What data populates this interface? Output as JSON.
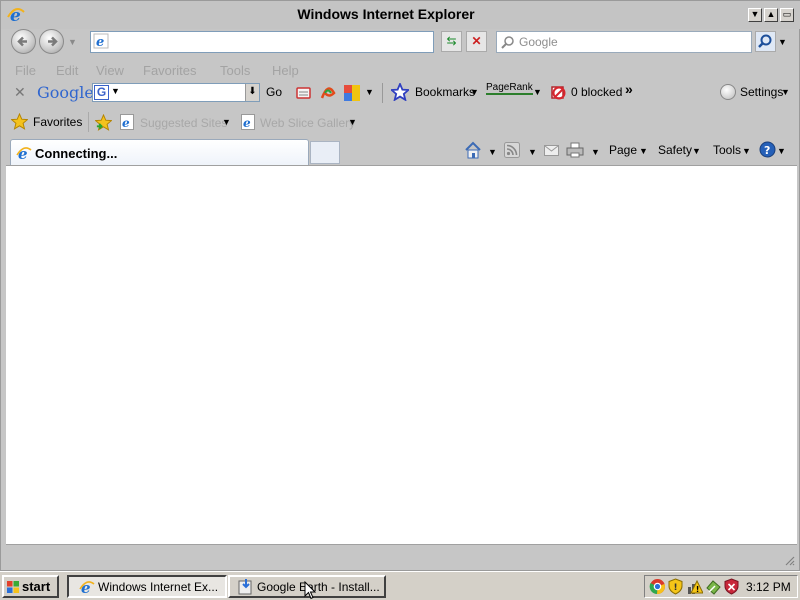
{
  "window": {
    "title": "Windows Internet Explorer"
  },
  "address": {
    "value": ""
  },
  "search": {
    "placeholder": "Google"
  },
  "menu": {
    "items": [
      "File",
      "Edit",
      "View",
      "Favorites",
      "Tools",
      "Help"
    ]
  },
  "google_toolbar": {
    "logo": "Google",
    "go_label": "Go",
    "bookmarks_label": "Bookmarks",
    "pagerank_label": "PageRank",
    "blocked_label": "0 blocked",
    "settings_label": "Settings",
    "more": "»"
  },
  "favorites_bar": {
    "favorites_label": "Favorites",
    "suggested_sites": "Suggested Sites",
    "web_slice_gallery": "Web Slice Gallery"
  },
  "tab": {
    "title": "Connecting..."
  },
  "command_bar": {
    "page": "Page",
    "safety": "Safety",
    "tools": "Tools"
  },
  "taskbar": {
    "start_label": "start",
    "buttons": [
      {
        "label": "Windows Internet Ex..."
      },
      {
        "label": "Google Earth - Install..."
      }
    ],
    "clock": "3:12 PM"
  },
  "colors": {
    "ie_blue": "#1f6fd0",
    "ie_gold": "#f2b21c",
    "bookmark_star": "#2f3fc0"
  }
}
